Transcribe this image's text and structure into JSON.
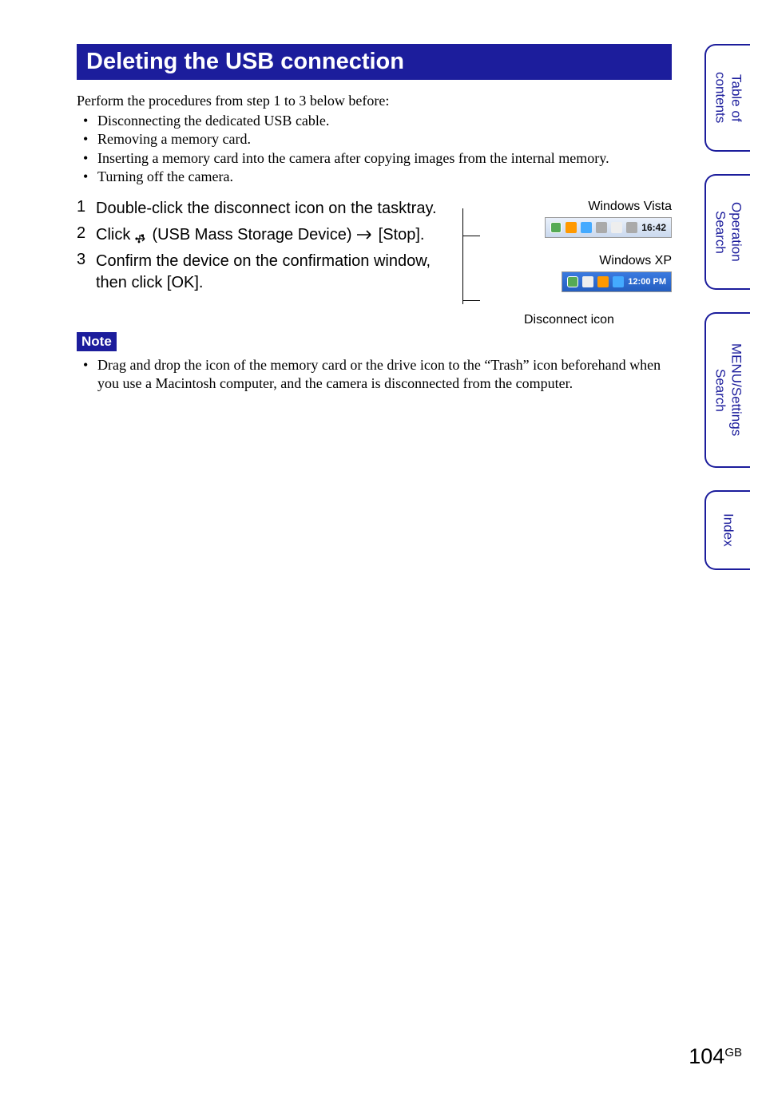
{
  "title": "Deleting the USB connection",
  "intro": "Perform the procedures from step 1 to 3 below before:",
  "bullets": [
    "Disconnecting the dedicated USB cable.",
    "Removing a memory card.",
    "Inserting a memory card into the camera after copying images from the internal memory.",
    "Turning off the camera."
  ],
  "steps": [
    {
      "num": "1",
      "text": "Double-click the disconnect icon on the tasktray."
    },
    {
      "num": "2",
      "prefix": "Click ",
      "device": "(USB Mass Storage Device)",
      "suffix": " [Stop]."
    },
    {
      "num": "3",
      "text": "Confirm the device on the confirmation window, then click [OK]."
    }
  ],
  "os_labels": {
    "vista": "Windows Vista",
    "xp": "Windows XP"
  },
  "tray_times": {
    "vista": "16:42",
    "xp": "12:00 PM"
  },
  "caption": "Disconnect icon",
  "note_label": "Note",
  "notes": [
    "Drag and drop the icon of the memory card or the drive icon to the “Trash” icon beforehand when you use a Macintosh computer, and the camera is disconnected from the computer."
  ],
  "side_tabs": [
    "Table of contents",
    "Operation Search",
    "MENU/Settings Search",
    "Index"
  ],
  "page_number": "104",
  "page_suffix": "GB"
}
